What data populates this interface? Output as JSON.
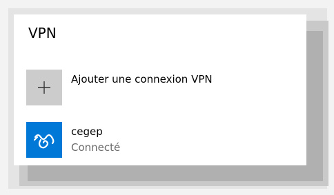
{
  "section": {
    "title": "VPN"
  },
  "add_connection": {
    "label": "Ajouter une connexion VPN",
    "icon": "plus-icon"
  },
  "connections": [
    {
      "name": "cegep",
      "status": "Connecté",
      "icon": "vpn-icon"
    }
  ],
  "colors": {
    "accent": "#0078d7",
    "add_tile": "#cccccc",
    "status_text": "#6b6b6b"
  }
}
